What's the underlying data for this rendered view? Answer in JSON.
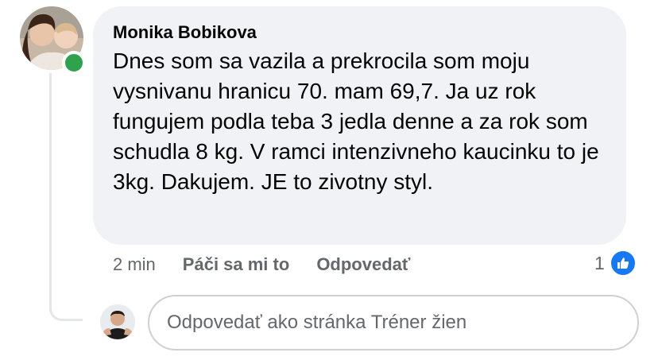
{
  "comment": {
    "author": "Monika Bobikova",
    "text": "Dnes som sa vazila a prekrocila som moju vysnivanu hranicu 70. mam 69,7. Ja uz rok fungujem podla teba 3 jedla denne a za rok som schudla 8 kg. V ramci intenzivneho kaucinku to je 3kg. Dakujem. JE to zivotny styl.",
    "online_status_color": "#31a24c"
  },
  "meta": {
    "time": "2 min",
    "like_label": "Páči sa mi to",
    "reply_label": "Odpovedať"
  },
  "reactions": {
    "count": "1",
    "icon": "thumbs-up-icon",
    "color": "#1877f2"
  },
  "reply": {
    "placeholder": "Odpovedať ako stránka Tréner žien"
  }
}
